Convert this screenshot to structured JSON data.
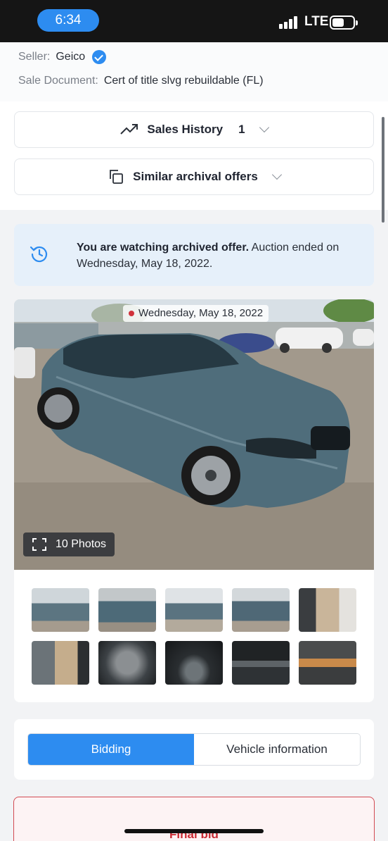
{
  "status_bar": {
    "time": "6:34",
    "network": "LTE"
  },
  "seller": {
    "seller_label": "Seller:",
    "seller_value": "Geico",
    "doc_label": "Sale Document:",
    "doc_value": "Cert of title slvg rebuildable (FL)"
  },
  "sales_history": {
    "label": "Sales History",
    "count": "1"
  },
  "similar_offers": {
    "label": "Similar archival offers"
  },
  "notice": {
    "bold": "You are watching archived offer.",
    "rest": " Auction ended on Wednesday, May 18, 2022."
  },
  "gallery": {
    "date": "Wednesday, May 18, 2022",
    "photos_button": "10 Photos",
    "thumbnail_count": 10
  },
  "tabs": {
    "bidding": "Bidding",
    "vehicle_info": "Vehicle information",
    "active": "bidding"
  },
  "final_bid": {
    "label": "Final bid"
  },
  "colors": {
    "accent": "#2d8cf0",
    "notice_bg": "#e6f0fa",
    "danger": "#c92b34"
  }
}
